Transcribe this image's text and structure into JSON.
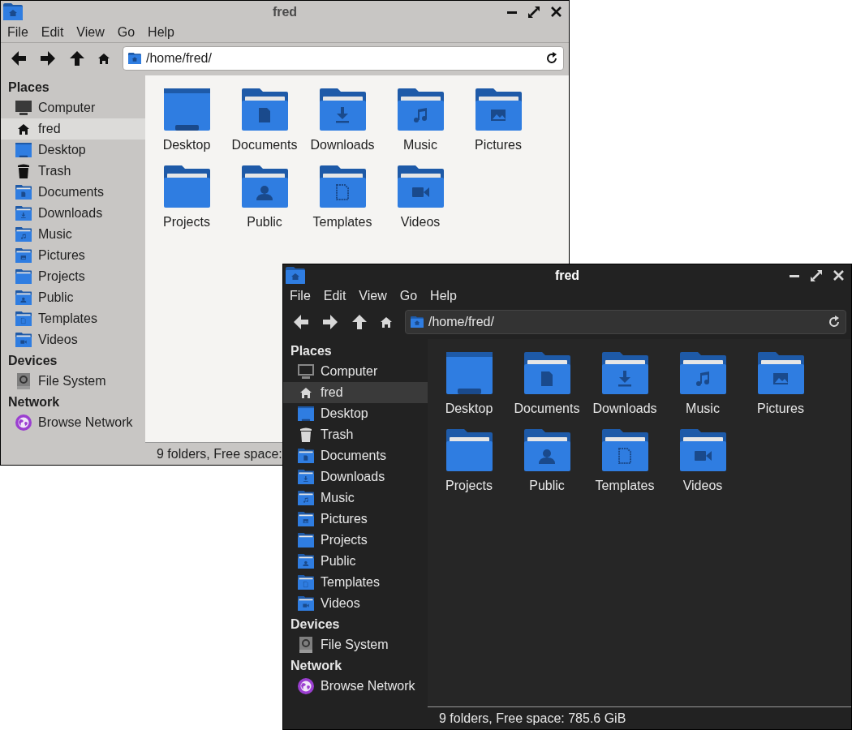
{
  "windows": [
    {
      "kind": "light",
      "title": "fred",
      "menu": [
        "File",
        "Edit",
        "View",
        "Go",
        "Help"
      ],
      "path": "/home/fred/",
      "sidebar": [
        {
          "heading": "Places",
          "items": [
            {
              "label": "Computer",
              "kind": "computer",
              "selected": false
            },
            {
              "label": "fred",
              "kind": "home",
              "selected": true
            },
            {
              "label": "Desktop",
              "kind": "desktop",
              "selected": false
            },
            {
              "label": "Trash",
              "kind": "trash",
              "selected": false
            },
            {
              "label": "Documents",
              "kind": "documents",
              "selected": false
            },
            {
              "label": "Downloads",
              "kind": "downloads",
              "selected": false
            },
            {
              "label": "Music",
              "kind": "music",
              "selected": false
            },
            {
              "label": "Pictures",
              "kind": "pictures",
              "selected": false
            },
            {
              "label": "Projects",
              "kind": "projects",
              "selected": false
            },
            {
              "label": "Public",
              "kind": "public",
              "selected": false
            },
            {
              "label": "Templates",
              "kind": "templates",
              "selected": false
            },
            {
              "label": "Videos",
              "kind": "videos",
              "selected": false
            }
          ]
        },
        {
          "heading": "Devices",
          "items": [
            {
              "label": "File System",
              "kind": "drive",
              "selected": false
            }
          ]
        },
        {
          "heading": "Network",
          "items": [
            {
              "label": "Browse Network",
              "kind": "network",
              "selected": false
            }
          ]
        }
      ],
      "files": [
        {
          "label": "Desktop",
          "kind": "desktop"
        },
        {
          "label": "Documents",
          "kind": "documents"
        },
        {
          "label": "Downloads",
          "kind": "downloads"
        },
        {
          "label": "Music",
          "kind": "music"
        },
        {
          "label": "Pictures",
          "kind": "pictures"
        },
        {
          "label": "Projects",
          "kind": "projects"
        },
        {
          "label": "Public",
          "kind": "public"
        },
        {
          "label": "Templates",
          "kind": "templates"
        },
        {
          "label": "Videos",
          "kind": "videos"
        }
      ],
      "status": "9 folders, Free space:"
    },
    {
      "kind": "dark",
      "title": "fred",
      "menu": [
        "File",
        "Edit",
        "View",
        "Go",
        "Help"
      ],
      "path": "/home/fred/",
      "sidebar": [
        {
          "heading": "Places",
          "items": [
            {
              "label": "Computer",
              "kind": "computer",
              "selected": false
            },
            {
              "label": "fred",
              "kind": "home",
              "selected": true
            },
            {
              "label": "Desktop",
              "kind": "desktop",
              "selected": false
            },
            {
              "label": "Trash",
              "kind": "trash",
              "selected": false
            },
            {
              "label": "Documents",
              "kind": "documents",
              "selected": false
            },
            {
              "label": "Downloads",
              "kind": "downloads",
              "selected": false
            },
            {
              "label": "Music",
              "kind": "music",
              "selected": false
            },
            {
              "label": "Pictures",
              "kind": "pictures",
              "selected": false
            },
            {
              "label": "Projects",
              "kind": "projects",
              "selected": false
            },
            {
              "label": "Public",
              "kind": "public",
              "selected": false
            },
            {
              "label": "Templates",
              "kind": "templates",
              "selected": false
            },
            {
              "label": "Videos",
              "kind": "videos",
              "selected": false
            }
          ]
        },
        {
          "heading": "Devices",
          "items": [
            {
              "label": "File System",
              "kind": "drive",
              "selected": false
            }
          ]
        },
        {
          "heading": "Network",
          "items": [
            {
              "label": "Browse Network",
              "kind": "network",
              "selected": false
            }
          ]
        }
      ],
      "files": [
        {
          "label": "Desktop",
          "kind": "desktop"
        },
        {
          "label": "Documents",
          "kind": "documents"
        },
        {
          "label": "Downloads",
          "kind": "downloads"
        },
        {
          "label": "Music",
          "kind": "music"
        },
        {
          "label": "Pictures",
          "kind": "pictures"
        },
        {
          "label": "Projects",
          "kind": "projects"
        },
        {
          "label": "Public",
          "kind": "public"
        },
        {
          "label": "Templates",
          "kind": "templates"
        },
        {
          "label": "Videos",
          "kind": "videos"
        }
      ],
      "status": "9 folders, Free space: 785.6 GiB"
    }
  ]
}
